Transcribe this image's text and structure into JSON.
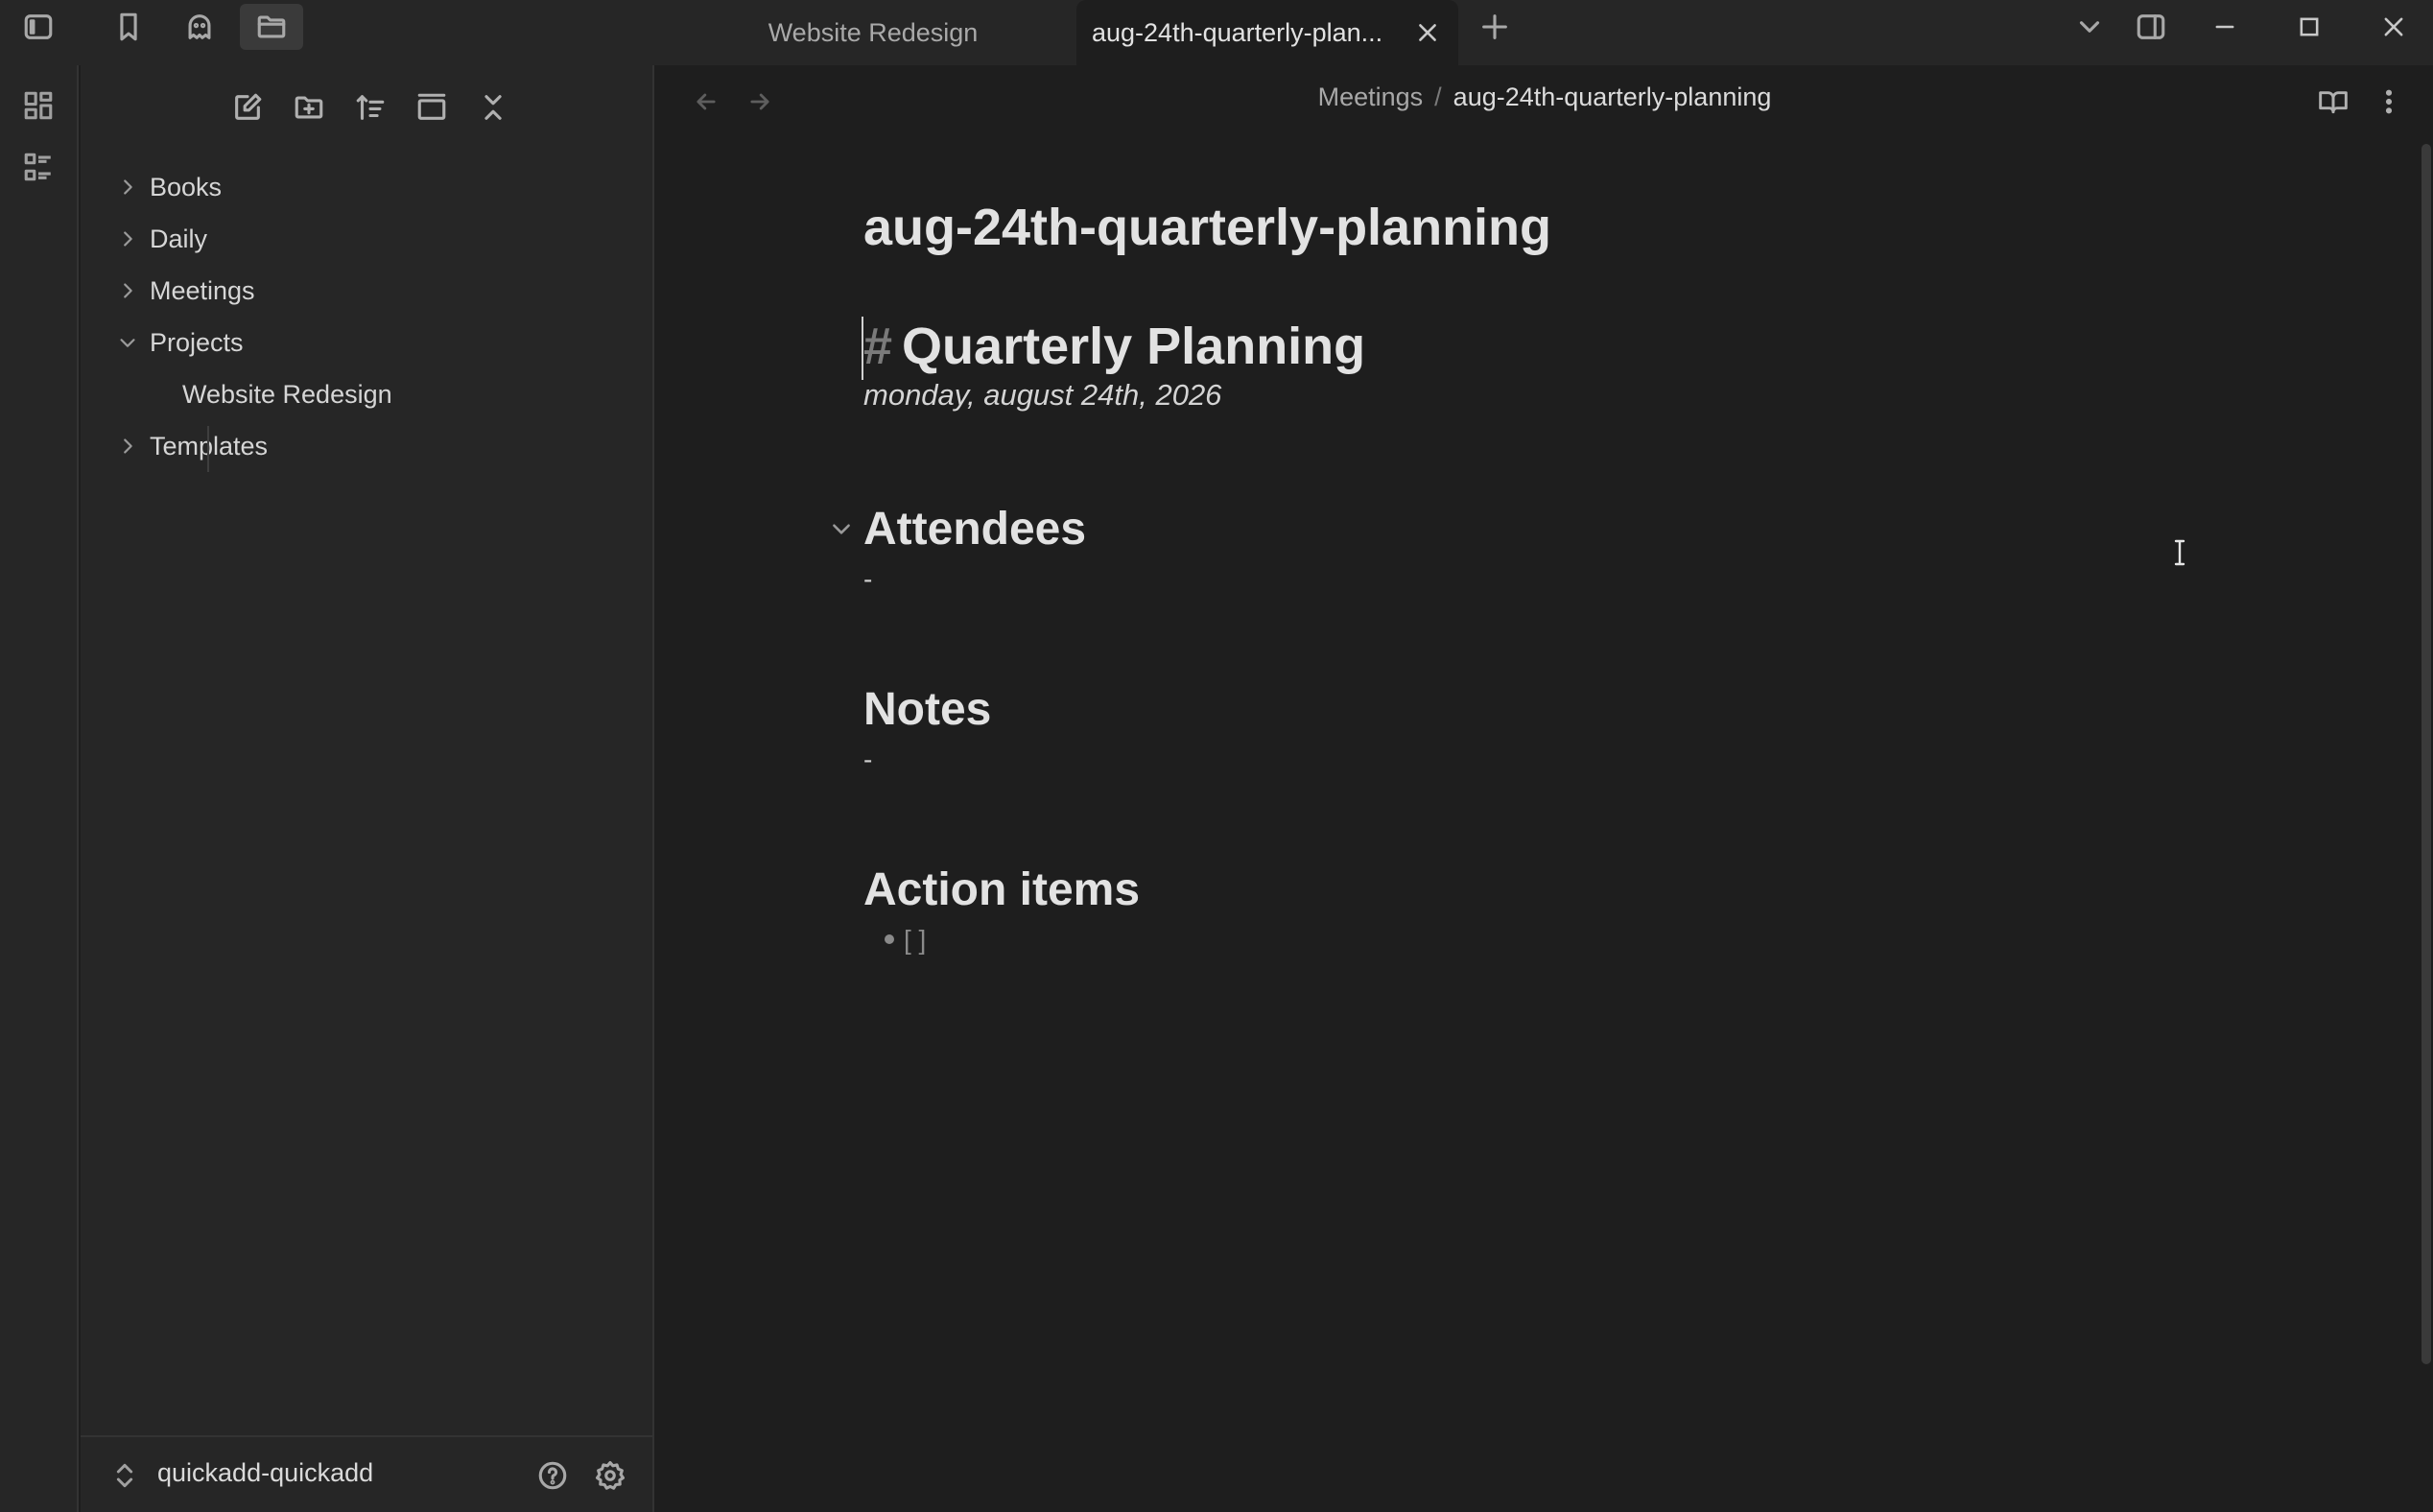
{
  "tabs": {
    "inactive_label": "Website Redesign",
    "active_label": "aug-24th-quarterly-plan..."
  },
  "sidebar": {
    "items": [
      {
        "label": "Books",
        "expanded": false
      },
      {
        "label": "Daily",
        "expanded": false
      },
      {
        "label": "Meetings",
        "expanded": false
      },
      {
        "label": "Projects",
        "expanded": true
      },
      {
        "label": "Website Redesign",
        "child": true
      },
      {
        "label": "Templates",
        "expanded": false
      }
    ],
    "vault_name": "quickadd-quickadd"
  },
  "breadcrumb": {
    "parent": "Meetings",
    "separator": "/",
    "current": "aug-24th-quarterly-planning"
  },
  "document": {
    "inline_title": "aug-24th-quarterly-planning",
    "h1_marker": "#",
    "h1_text": "Quarterly Planning",
    "date_line": "monday, august 24th, 2026",
    "sections": [
      {
        "heading": "Attendees",
        "body": "-"
      },
      {
        "heading": "Notes",
        "body": "-"
      },
      {
        "heading": "Action items",
        "body": "[ ]"
      }
    ]
  },
  "colors": {
    "background": "#1e1e1e",
    "panel": "#262626",
    "text": "#dadada",
    "muted": "#a8a8a8"
  },
  "icons": {
    "titlebar": [
      "sidebar-toggle-icon",
      "bookmark-icon",
      "ghost-icon",
      "folder-icon"
    ],
    "ribbon": [
      "dashboard-icon",
      "outline-list-icon"
    ],
    "sidebar_toolbar": [
      "new-note-icon",
      "new-folder-icon",
      "sort-icon",
      "collapse-view-icon",
      "collapse-all-icon"
    ],
    "footer": [
      "help-icon",
      "settings-icon"
    ]
  }
}
